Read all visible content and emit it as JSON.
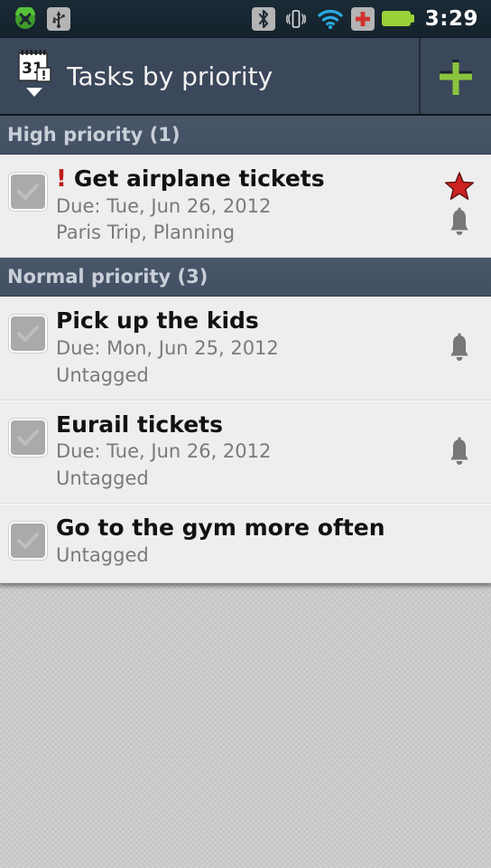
{
  "status_bar": {
    "time": "3:29",
    "left_icons": [
      {
        "name": "sync-icon",
        "color": "#4caf2f"
      },
      {
        "name": "usb-icon",
        "color": "#2b2b2b"
      }
    ],
    "right_icons": [
      {
        "name": "bluetooth-icon",
        "color": "#1f2a33"
      },
      {
        "name": "vibrate-icon",
        "color": "#d8d8d8"
      },
      {
        "name": "wifi-icon",
        "color": "#2aa9e0"
      },
      {
        "name": "medical-cross-icon",
        "color": "#d2322d"
      },
      {
        "name": "battery-icon",
        "color": "#9ad038"
      }
    ],
    "background": "#16252f"
  },
  "title_bar": {
    "title": "Tasks by priority",
    "app_icon": "calendar-31-alert-icon",
    "app_icon_day": "31",
    "dropdown": "chevron-down-icon",
    "add_button": "add-task-button",
    "add_label": "+",
    "accent": "#8ac43f",
    "background": "#3b475a"
  },
  "sections": [
    {
      "header": "High priority (1)",
      "tasks": [
        {
          "title": "Get airplane tickets",
          "priority_mark": "!",
          "due": "Due: Tue, Jun 26, 2012",
          "tags": "Paris Trip, Planning",
          "starred": true,
          "reminder": true,
          "checked": false
        }
      ]
    },
    {
      "header": "Normal priority (3)",
      "tasks": [
        {
          "title": "Pick up the kids",
          "priority_mark": "",
          "due": "Due: Mon, Jun 25, 2012",
          "tags": "Untagged",
          "starred": false,
          "reminder": true,
          "checked": false
        },
        {
          "title": "Eurail tickets",
          "priority_mark": "",
          "due": "Due: Tue, Jun 26, 2012",
          "tags": "Untagged",
          "starred": false,
          "reminder": true,
          "checked": false
        },
        {
          "title": "Go to the gym more often",
          "priority_mark": "",
          "due": "",
          "tags": "Untagged",
          "starred": false,
          "reminder": false,
          "checked": false
        }
      ]
    }
  ],
  "colors": {
    "section_header_bg": "#46536a",
    "row_bg": "#eeeeee",
    "star_red": "#cc2222",
    "bell_gray": "#777777",
    "priority_red": "#c01a1a",
    "empty_bg": "#c9c9c9"
  }
}
